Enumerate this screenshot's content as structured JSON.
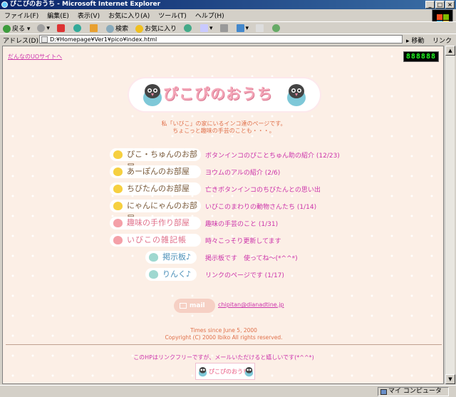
{
  "window": {
    "title": "ぴこぴのおうち - Microsoft Internet Explorer",
    "buttons": [
      "_",
      "□",
      "×"
    ]
  },
  "menu": [
    "ファイル(F)",
    "編集(E)",
    "表示(V)",
    "お気に入り(A)",
    "ツール(T)",
    "ヘルプ(H)"
  ],
  "toolbar": {
    "back": "戻る",
    "search": "検索",
    "favorites": "お気に入り"
  },
  "address": {
    "label": "アドレス(D)",
    "value": "D:¥Homepage¥Ver1¥pico¥index.html",
    "go": "移動",
    "links": "リンク"
  },
  "page": {
    "back_link": "だんなのUOサイトへ",
    "counter": "888888",
    "logo_title": "ぴこぴのおうち",
    "intro": [
      "私「いびこ」の家にいるインコ達のページです。",
      "ちょこっと趣味の手芸のことも・・・。"
    ],
    "items": [
      {
        "label": "ぴこ・ちゅんのお部屋",
        "desc": "ボタンインコのぴことちゅん助の紹介 (12/23)"
      },
      {
        "label": "あーぽんのお部屋",
        "desc": "ヨウムのアルの紹介 (2/6)"
      },
      {
        "label": "ちびたんのお部屋",
        "desc": "亡きボタンインコのちびたんとの思い出"
      },
      {
        "label": "にゃんにゃんのお部屋",
        "desc": "いびこのまわりの動物さんたち (1/14)"
      },
      {
        "label": "趣味の手作り部屋",
        "desc": "趣味の手芸のこと (1/31)"
      },
      {
        "label": "いびこの雑記帳",
        "desc": "時々こっそり更新してます"
      },
      {
        "label": "掲示板♪",
        "desc": "掲示板です　使ってね～(*^^*)"
      },
      {
        "label": "りんく♪",
        "desc": "リンクのページです (1/17)"
      }
    ],
    "mail_label": "mail",
    "email": "chipitan@dianadtine.jp",
    "since": "Times since June 5, 2000",
    "copyright": "Copyright (C) 2000 Ibiko All rights reserved.",
    "linkfree": "このHPはリンクフリーですが、メールいただけると嬉しいです(*^^*)",
    "banner_title": "ぴこぴのおうち"
  },
  "status": {
    "zone": "マイ コンピュータ"
  },
  "colors": {
    "accent_pink": "#cc33aa",
    "orange": "#e0704a",
    "background": "#fcefe6"
  }
}
